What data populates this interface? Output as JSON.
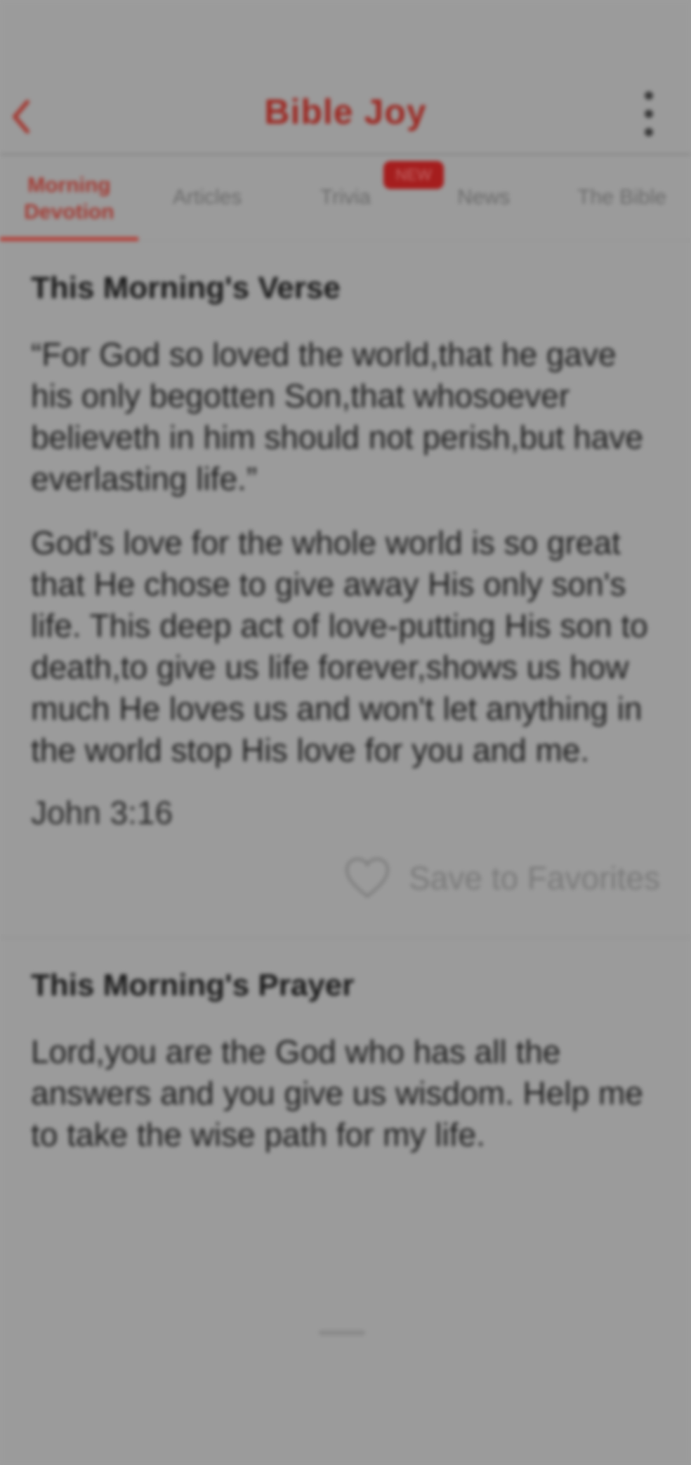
{
  "header": {
    "title": "Bible Joy"
  },
  "tabs": [
    {
      "label": "Morning Devotion",
      "active": true
    },
    {
      "label": "Articles",
      "active": false
    },
    {
      "label": "Trivia",
      "active": false
    },
    {
      "label": "News",
      "active": false
    },
    {
      "label": "The Bible",
      "active": false
    }
  ],
  "badge": {
    "label": "NEW"
  },
  "verse_section": {
    "title": "This Morning's Verse",
    "verse": "“For God so loved the world,that he gave his only begotten Son,that whosoever believeth in him should not perish,but have everlasting life.”",
    "devotional": "God's love for the whole world is so great that He chose to give away His only son's life. This deep act of love-putting His son to death,to give us life forever,shows us how much He loves us and won't let anything in the world stop His love for you and me.",
    "reference": "John 3:16",
    "favorite_label": "Save to Favorites"
  },
  "prayer_section": {
    "title": "This Morning's Prayer",
    "prayer": "Lord,you are the God who has all the answers and you give us wisdom. Help me to take the wise path for my life."
  },
  "colors": {
    "accent": "#a33a33",
    "badge": "#a51e1e",
    "overlay": "#9b9b9b"
  }
}
